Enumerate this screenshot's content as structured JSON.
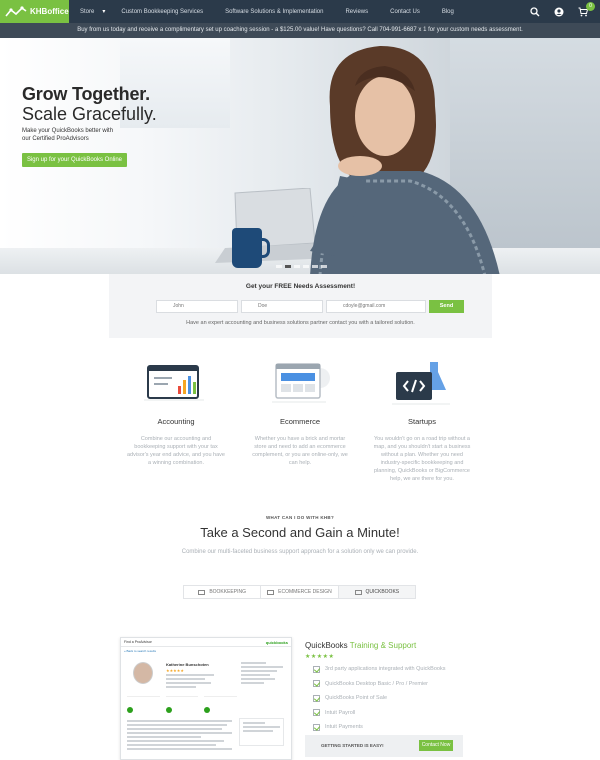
{
  "nav": {
    "logo_text": "KHBoffice",
    "items": [
      "Store",
      "Custom Bookkeeping Services",
      "Software Solutions & Implementation",
      "Reviews",
      "Contact Us",
      "Blog"
    ],
    "cart_count": "0"
  },
  "promo": {
    "text": "Buy from us today and receive a complimentary set up coaching session - a $125.00 value! Have questions? Call 704-991-6687 x 1 for your custom needs assessment."
  },
  "hero": {
    "title": "Grow Together.",
    "subtitle": "Scale Gracefully.",
    "sub_line1": "Make your QuickBooks better with",
    "sub_line2": "our Certified ProAdvisors",
    "cta": "Sign up for your QuickBooks Online"
  },
  "assessment": {
    "title": "Get your FREE Needs Assessment!",
    "first_name": "John",
    "last_name": "Doe",
    "email": "cdoyle@gmail.com",
    "send": "Send",
    "note": "Have an expert accounting and business solutions partner contact you with a tailored solution."
  },
  "features": [
    {
      "title": "Accounting",
      "desc": "Combine our accounting and bookkeeping support with your tax advisor's year end advice, and you have a winning combination."
    },
    {
      "title": "Ecommerce",
      "desc": "Whether you have a brick and mortar store and need to add an ecommerce complement, or you are online-only, we can help."
    },
    {
      "title": "Startups",
      "desc": "You wouldn't go on a road trip without a map, and you shouldn't start a business without a plan. Whether you need industry-specific bookkeeping and planning, QuickBooks or BigCommerce help, we are there for you."
    }
  ],
  "section2": {
    "eyebrow": "WHAT CAN I DO WITH KHB?",
    "title": "Take a Second and Gain a Minute!",
    "lede": "Combine our multi-faceted business support approach for a solution only we can provide.",
    "tabs": [
      "BOOKKEEPING",
      "ECOMMERCE DESIGN",
      "QUICKBOOKS"
    ]
  },
  "doc": {
    "header": "Find a ProAdvisor",
    "brand": "quickbooks",
    "crumb": "« Back to search results",
    "name": "Katherine Bunschoten",
    "stars": "★★★★★"
  },
  "quickbooks": {
    "title_a": "QuickBooks",
    "title_b": "Training & Support",
    "stars": "★★★★★",
    "items": [
      "3rd party applications integrated with QuickBooks",
      "QuickBooks Desktop Basic / Pro / Premier",
      "QuickBooks Point of Sale",
      "Intuit Payroll",
      "Intuit Payments"
    ],
    "started": "GETTING STARTED IS EASY!",
    "contact": "Contact Now"
  },
  "colors": {
    "brand_green": "#7ac142",
    "nav_bg": "#2b3a4a",
    "promo_bg": "#3e4a57"
  }
}
